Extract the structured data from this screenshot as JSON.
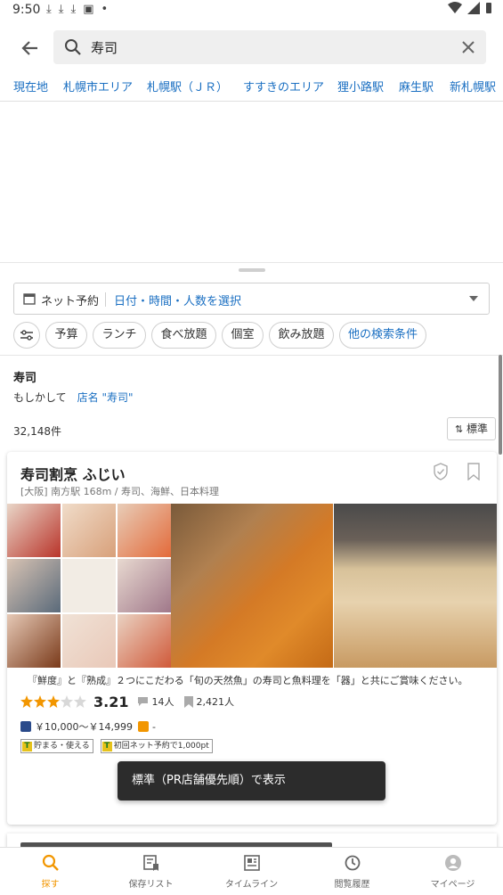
{
  "status_bar": {
    "time": "9:50"
  },
  "search": {
    "query": "寿司"
  },
  "area_tabs": [
    "現在地",
    "札幌市エリア",
    "札幌駅（ＪＲ）",
    "すすきのエリア",
    "狸小路駅",
    "麻生駅",
    "新札幌駅"
  ],
  "reserve": {
    "label": "ネット予約",
    "select_text": "日付・時間・人数を選択"
  },
  "filter_chips": [
    "予算",
    "ランチ",
    "食べ放題",
    "個室",
    "飲み放題",
    "他の検索条件"
  ],
  "query_title": "寿司",
  "suggestion": {
    "prefix": "もしかして",
    "link": "店名 \"寿司\""
  },
  "result_count": "32,148件",
  "sort_label": "標準",
  "restaurant": {
    "name": "寿司割烹 ふじい",
    "meta": "[大阪] 南方駅 168m / 寿司、海鮮、日本料理",
    "description": "『鮮度』と『熟成』２つにこだわる「旬の天然魚」の寿司と魚料理を「器」と共にご賞味ください。",
    "rating": "3.21",
    "rating_value": 3.21,
    "reviews": "14人",
    "saves": "2,421人",
    "dinner_price": "￥10,000～￥14,999",
    "lunch_price": "-",
    "badges": [
      "貯まる・使える",
      "初回ネット予約で1,000pt"
    ]
  },
  "toast": "標準（PR店舗優先順）で表示",
  "bottom_nav": [
    "探す",
    "保存リスト",
    "タイムライン",
    "閲覧履歴",
    "マイページ"
  ],
  "colors": {
    "accent": "#f29600",
    "link": "#1a6fc2",
    "star": "#f29600"
  }
}
